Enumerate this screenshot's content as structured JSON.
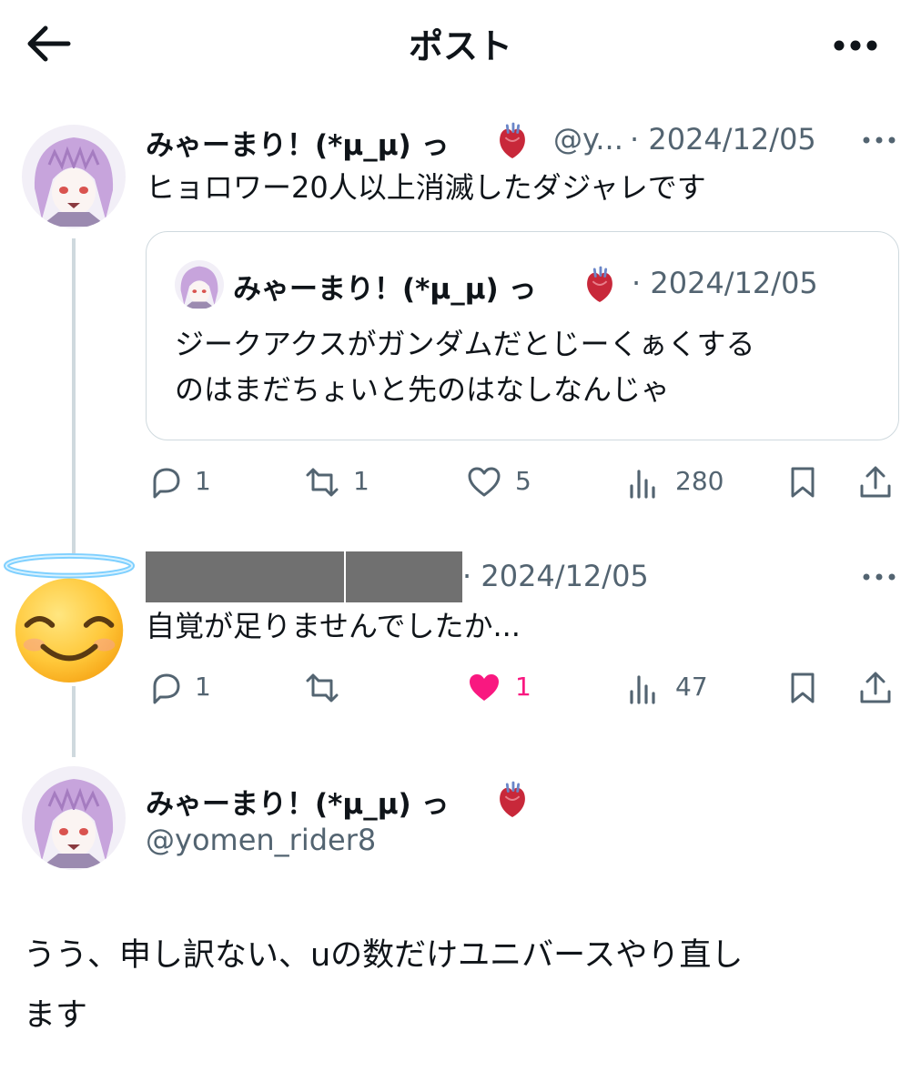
{
  "header": {
    "title": "ポスト",
    "back_icon": "arrow-left-icon",
    "more_icon": "more-horizontal-icon"
  },
  "colors": {
    "text": "#0f1419",
    "secondary": "#536471",
    "border": "#cfd9de",
    "like_active": "#f91880"
  },
  "post1": {
    "display_name": "みゃーまり！(*μ_μ) っ",
    "name_emoji": "anatomical-heart",
    "handle": "@y...",
    "date": "· 2024/12/05",
    "text": "ヒョロワー20人以上消滅したダジャレです",
    "quote": {
      "display_name": "みゃーまり！(*μ_μ) っ",
      "date": "· 2024/12/05",
      "text_line1": "ジークアクスがガンダムだとじーくぁくする",
      "text_line2": "のはまだちょいと先のはなしなんじゃ"
    },
    "actions": {
      "replies": "1",
      "reposts": "1",
      "likes": "5",
      "views": "280"
    }
  },
  "post2": {
    "avatar_icon": "smiling-face-with-halo-emoji",
    "date": "· 2024/12/05",
    "text": "自覚が足りませんでしたか...",
    "actions": {
      "replies": "1",
      "reposts": "",
      "likes": "1",
      "views": "47"
    }
  },
  "post3": {
    "display_name": "みゃーまり！(*μ_μ) っ",
    "handle": "@yomen_rider8",
    "text_line1": "うう、申し訳ない、uの数だけユニバースやり直し",
    "text_line2": "ます"
  }
}
